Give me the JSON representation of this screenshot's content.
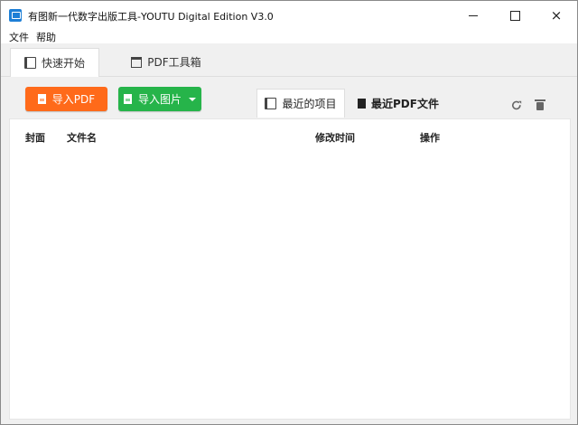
{
  "window": {
    "title": "有图新一代数字出版工具-YOUTU Digital Edition V3.0",
    "controls": [
      "minimize",
      "maximize",
      "close"
    ]
  },
  "menubar": {
    "items": [
      "文件",
      "帮助"
    ]
  },
  "main_tabs": [
    {
      "label": "快速开始",
      "icon": "book-icon",
      "active": true
    },
    {
      "label": "PDF工具箱",
      "icon": "toolbox-icon",
      "active": false
    }
  ],
  "actions": {
    "import_pdf": "导入PDF",
    "import_image": "导入图片"
  },
  "sub_tabs": [
    {
      "label": "最近的项目",
      "icon": "book-icon",
      "active": true
    },
    {
      "label": "最近PDF文件",
      "icon": "pdf-file-icon",
      "active": false
    }
  ],
  "toolbar_icons": [
    "refresh-icon",
    "trash-icon"
  ],
  "table": {
    "columns": [
      "封面",
      "文件名",
      "修改时间",
      "操作"
    ],
    "rows": []
  },
  "colors": {
    "pdf_button": "#ff6a1a",
    "image_button": "#26b44a",
    "background": "#f0f0f0"
  }
}
